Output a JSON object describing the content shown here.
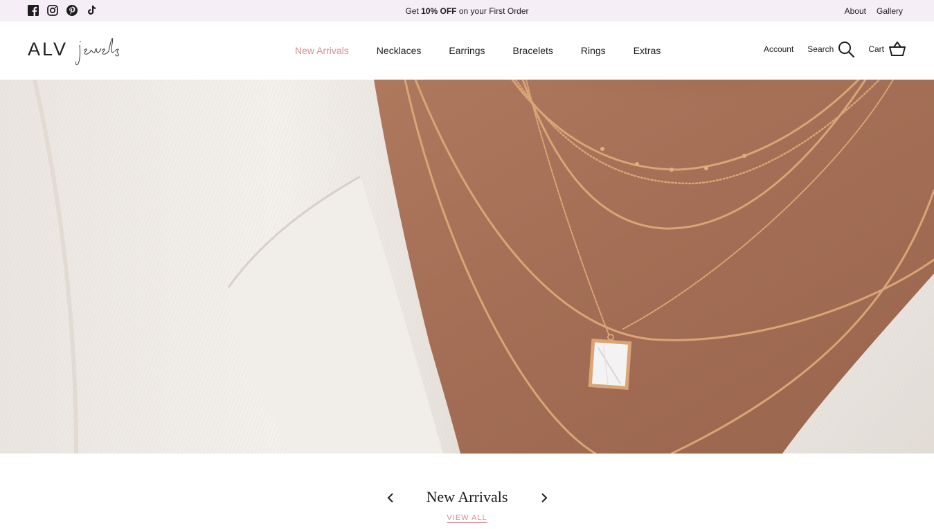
{
  "announcement": {
    "social_icons": [
      "facebook-icon",
      "instagram-icon",
      "pinterest-icon",
      "tiktok-icon"
    ],
    "promo_prefix": "Get ",
    "promo_bold": "10% OFF",
    "promo_suffix": " on your First Order",
    "links": [
      "About",
      "Gallery"
    ],
    "background": "#f6eef6"
  },
  "header": {
    "logo_text": "ALV",
    "logo_script": "jewels",
    "nav": [
      "New Arrivals",
      "Necklaces",
      "Earrings",
      "Bracelets",
      "Rings",
      "Extras"
    ],
    "active_nav": "New Arrivals",
    "account": "Account",
    "search": "Search",
    "cart": "Cart"
  },
  "hero": {
    "image": "layered-gold-necklaces-on-model"
  },
  "section": {
    "title": "New Arrivals",
    "view_all": "VIEW ALL"
  },
  "colors": {
    "accent": "#d98e93",
    "text": "#1d1d1d",
    "topbar": "#f6eef6"
  }
}
